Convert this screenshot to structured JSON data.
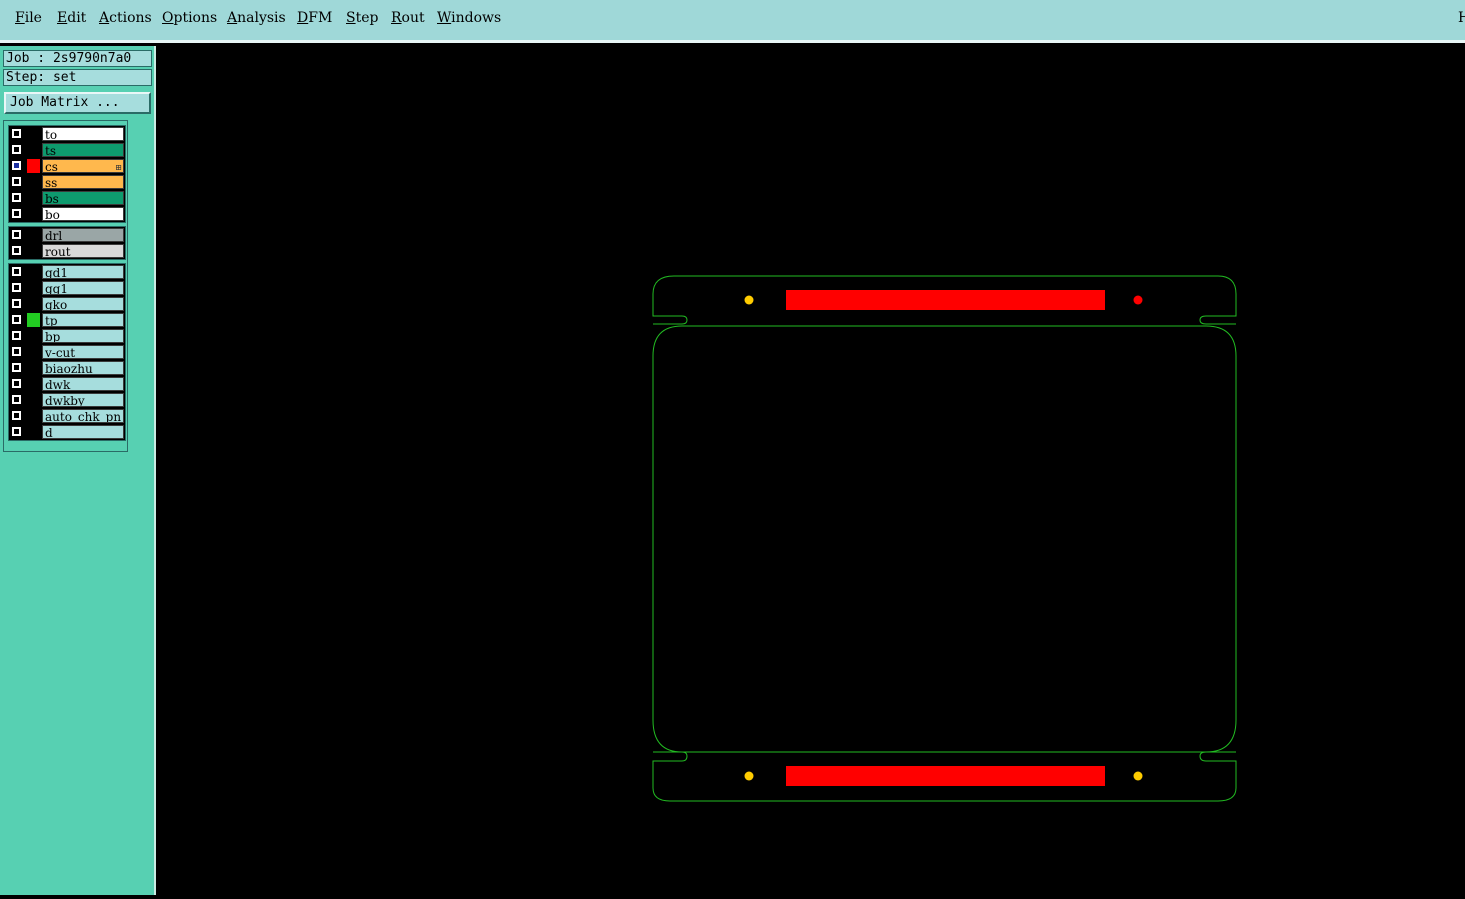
{
  "menubar": {
    "items": [
      "File",
      "Edit",
      "Actions",
      "Options",
      "Analysis",
      "DFM",
      "Step",
      "Rout",
      "Windows"
    ],
    "right_label": "H"
  },
  "info": {
    "job": "Job : 2s9790n7a0",
    "step": "Step: set",
    "job_matrix": "Job Matrix ..."
  },
  "layers": {
    "group1": [
      {
        "name": "to",
        "bg": "#ffffff",
        "swatch": "",
        "active": false
      },
      {
        "name": "ts",
        "bg": "#0e9b6e",
        "swatch": "",
        "active": false
      },
      {
        "name": "cs",
        "bg": "#ffb84d",
        "swatch": "#ff0000",
        "active": true
      },
      {
        "name": "ss",
        "bg": "#ffb84d",
        "swatch": "",
        "active": false
      },
      {
        "name": "bs",
        "bg": "#0e9b6e",
        "swatch": "",
        "active": false
      },
      {
        "name": "bo",
        "bg": "#ffffff",
        "swatch": "",
        "active": false
      }
    ],
    "group2": [
      {
        "name": "drl",
        "bg": "#9aa6a6",
        "swatch": "",
        "active": false
      },
      {
        "name": "rout",
        "bg": "#d9d9d9",
        "swatch": "",
        "active": false
      }
    ],
    "group3": [
      {
        "name": "gd1",
        "bg": "#a6dddd",
        "swatch": "",
        "active": false
      },
      {
        "name": "gg1",
        "bg": "#a6dddd",
        "swatch": "",
        "active": false
      },
      {
        "name": "gko",
        "bg": "#a6dddd",
        "swatch": "",
        "active": false
      },
      {
        "name": "tp",
        "bg": "#a6dddd",
        "swatch": "#22cc22",
        "active": false
      },
      {
        "name": "bp",
        "bg": "#a6dddd",
        "swatch": "",
        "active": false
      },
      {
        "name": "v-cut",
        "bg": "#a6dddd",
        "swatch": "",
        "active": false
      },
      {
        "name": "biaozhu",
        "bg": "#a6dddd",
        "swatch": "",
        "active": false
      },
      {
        "name": "dwk",
        "bg": "#a6dddd",
        "swatch": "",
        "active": false
      },
      {
        "name": "dwkby",
        "bg": "#a6dddd",
        "swatch": "",
        "active": false
      },
      {
        "name": "auto_chk_pn",
        "bg": "#a6dddd",
        "swatch": "",
        "active": false
      },
      {
        "name": "d",
        "bg": "#a6dddd",
        "swatch": "",
        "active": false
      }
    ]
  },
  "colors": {
    "outline": "#22bb22",
    "pad": "#ff0000",
    "fiducial": "#ffcc00",
    "fiducial_active": "#ff0000"
  }
}
